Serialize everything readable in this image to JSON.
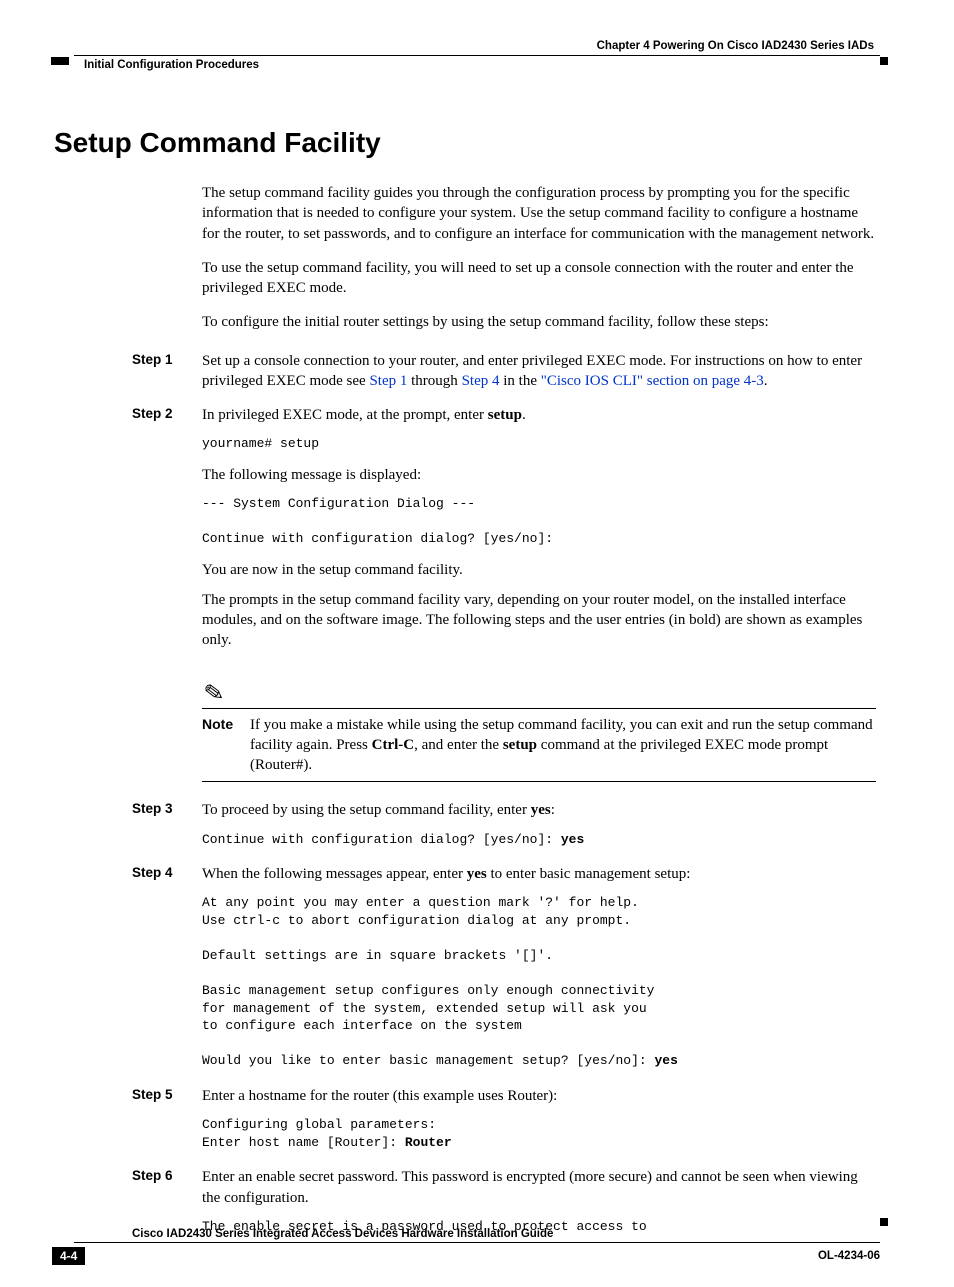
{
  "header": {
    "chapter": "Chapter 4      Powering On Cisco IAD2430 Series IADs",
    "section": "Initial Configuration Procedures"
  },
  "title": "Setup Command Facility",
  "intro": {
    "p1": "The setup command facility guides you through the configuration process by prompting you for the specific information that is needed to configure your system. Use the setup command facility to configure a hostname for the router, to set passwords, and to configure an interface for communication with the management network.",
    "p2": "To use the setup command facility, you will need to set up a console connection with the router and enter the privileged EXEC mode.",
    "p3": "To configure the initial router settings by using the setup command facility, follow these steps:"
  },
  "steps": {
    "s1": {
      "label": "Step 1",
      "text_a": "Set up a console connection to your router, and enter privileged EXEC mode. For instructions on how to enter privileged EXEC mode see ",
      "link1": "Step 1",
      "text_b": " through ",
      "link2": "Step 4",
      "text_c": " in the ",
      "link3": "\"Cisco IOS CLI\" section on page 4-3",
      "text_d": "."
    },
    "s2": {
      "label": "Step 2",
      "text_a": "In privileged EXEC mode, at the prompt, enter ",
      "bold": "setup",
      "text_b": ".",
      "code1": "yourname# setup",
      "p2": "The following message is displayed:",
      "code2": "--- System Configuration Dialog ---\n\nContinue with configuration dialog? [yes/no]:",
      "p3": "You are now in the setup command facility.",
      "p4": "The prompts in the setup command facility vary, depending on your router model, on the installed interface modules, and on the software image. The following steps and the user entries (in bold) are shown as examples only."
    },
    "s3": {
      "label": "Step 3",
      "text_a": "To proceed by using the setup command facility, enter ",
      "bold": "yes",
      "text_b": ":",
      "code_a": "Continue with configuration dialog? [yes/no]: ",
      "code_bold": "yes"
    },
    "s4": {
      "label": "Step 4",
      "text_a": "When the following messages appear, enter ",
      "bold": "yes",
      "text_b": " to enter basic management setup:",
      "code_a": "At any point you may enter a question mark '?' for help.\nUse ctrl-c to abort configuration dialog at any prompt.\n\nDefault settings are in square brackets '[]'.\n\nBasic management setup configures only enough connectivity\nfor management of the system, extended setup will ask you\nto configure each interface on the system\n\nWould you like to enter basic management setup? [yes/no]: ",
      "code_bold": "yes"
    },
    "s5": {
      "label": "Step 5",
      "text": "Enter a hostname for the router (this example uses Router):",
      "code_a": "Configuring global parameters:\nEnter host name [Router]: ",
      "code_bold": "Router"
    },
    "s6": {
      "label": "Step 6",
      "text": "Enter an enable secret password. This password is encrypted (more secure) and cannot be seen when viewing the configuration.",
      "code": "The enable secret is a password used to protect access to"
    }
  },
  "note": {
    "label": "Note",
    "text_a": "If you make a mistake while using the setup command facility, you can exit and run the setup command facility again. Press ",
    "bold1": "Ctrl-C",
    "text_b": ", and enter the ",
    "bold2": "setup",
    "text_c": " command at the privileged EXEC mode prompt (Router#)."
  },
  "footer": {
    "guide": "Cisco IAD2430 Series Integrated Access Devices Hardware Installation Guide",
    "page": "4-4",
    "doc": "OL-4234-06"
  }
}
